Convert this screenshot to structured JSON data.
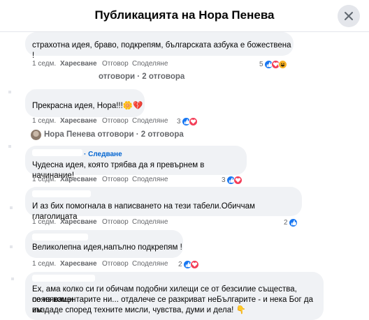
{
  "header": {
    "title": "Публикацията на Нора Пенева"
  },
  "comments": [
    {
      "text": "страхотна идея, браво, подкрепям, българската азбука е божествена !",
      "time": "1 седм.",
      "like": "Харесване",
      "reply": "Отговор",
      "share": "Споделяне",
      "reactions_count": "5",
      "reactions": [
        "like-icon",
        "love-icon",
        "haha-icon"
      ]
    },
    {
      "text": "Прекрасна идея, Нора!!!🌼💔",
      "time": "1 седм.",
      "like": "Харесване",
      "reply": "Отговор",
      "share": "Споделяне",
      "reactions_count": "3",
      "reactions": [
        "like-icon",
        "love-icon"
      ]
    },
    {
      "follow": "· Следване",
      "text": "Чудесна идея, която трябва да я превърнем в начинание!",
      "time": "1 седм.",
      "like": "Харесване",
      "reply": "Отговор",
      "share": "Споделяне",
      "reactions_count": "3",
      "reactions": [
        "like-icon",
        "love-icon"
      ]
    },
    {
      "text": "И аз бих помогнала в написването на тези табели.Обиччам глаголицата",
      "time": "1 седм.",
      "like": "Харесване",
      "reply": "Отговор",
      "share": "Споделяне",
      "reactions_count": "2",
      "reactions": [
        "like-icon"
      ]
    },
    {
      "text": "Великолепна идея,напълно подкрепям !",
      "time": "1 седм.",
      "like": "Харесване",
      "reply": "Отговор",
      "share": "Споделяне",
      "reactions_count": "2",
      "reactions": [
        "like-icon",
        "love-icon"
      ]
    },
    {
      "text_lines": [
        "Ех, ама колко си ги обичам подобни хилещи се от безсилие същества, появяващи",
        "се из коментарите ни... отдалече се разкриват неБългарите - и нека Бог да им",
        "въздаде според техните мисли, чувства, думи и дела! 👇"
      ]
    }
  ],
  "reply_threads": [
    {
      "text": "отговори · 2 отговора"
    },
    {
      "text": "Нора Пенева отговори · 2 отговора"
    }
  ],
  "colors": {
    "like": "#1877f2",
    "love": "#f33e58",
    "haha": "#f7b125",
    "link": "#0064d1"
  }
}
